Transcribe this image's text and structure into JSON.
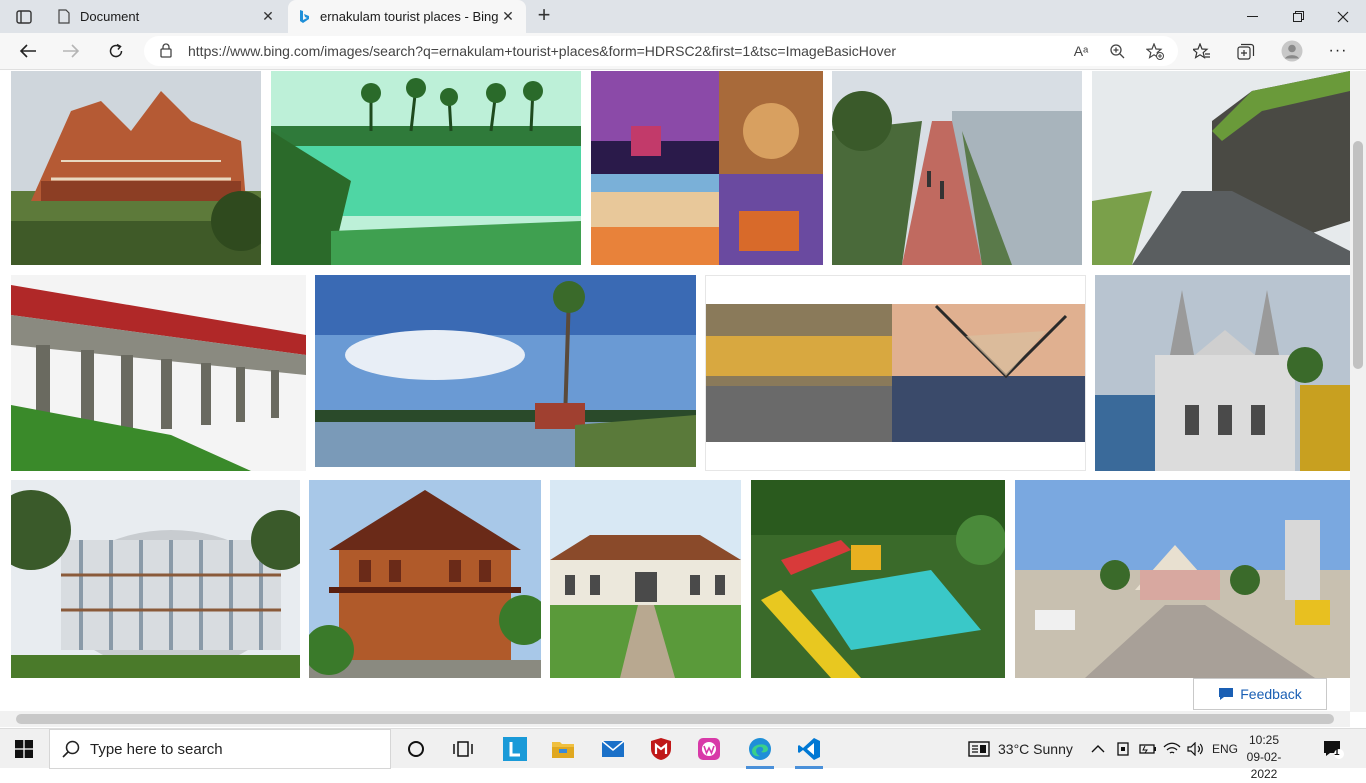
{
  "browser": {
    "tabs": [
      {
        "title": "Document",
        "active": false
      },
      {
        "title": "ernakulam tourist places - Bing images",
        "active": true
      }
    ],
    "url": "https://www.bing.com/images/search?q=ernakulam+tourist+places&form=HDRSC2&first=1&tsc=ImageBasicHover",
    "reader_label": "Aᵃ"
  },
  "feedback": {
    "label": "Feedback"
  },
  "taskbar": {
    "search_placeholder": "Type here to search",
    "weather": "33°C  Sunny",
    "language": "ENG",
    "time": "10:25",
    "date": "09-02-2022",
    "notification_count": "1",
    "apps": [
      "task-view",
      "lens-app",
      "file-explorer",
      "mail",
      "mcafee",
      "app-w",
      "edge",
      "vscode"
    ]
  },
  "colors": {
    "accent": "#0067c0",
    "edge_blue": "#1f8fd8",
    "vscode_blue": "#0078d4",
    "mcafee_red": "#c01818"
  }
}
